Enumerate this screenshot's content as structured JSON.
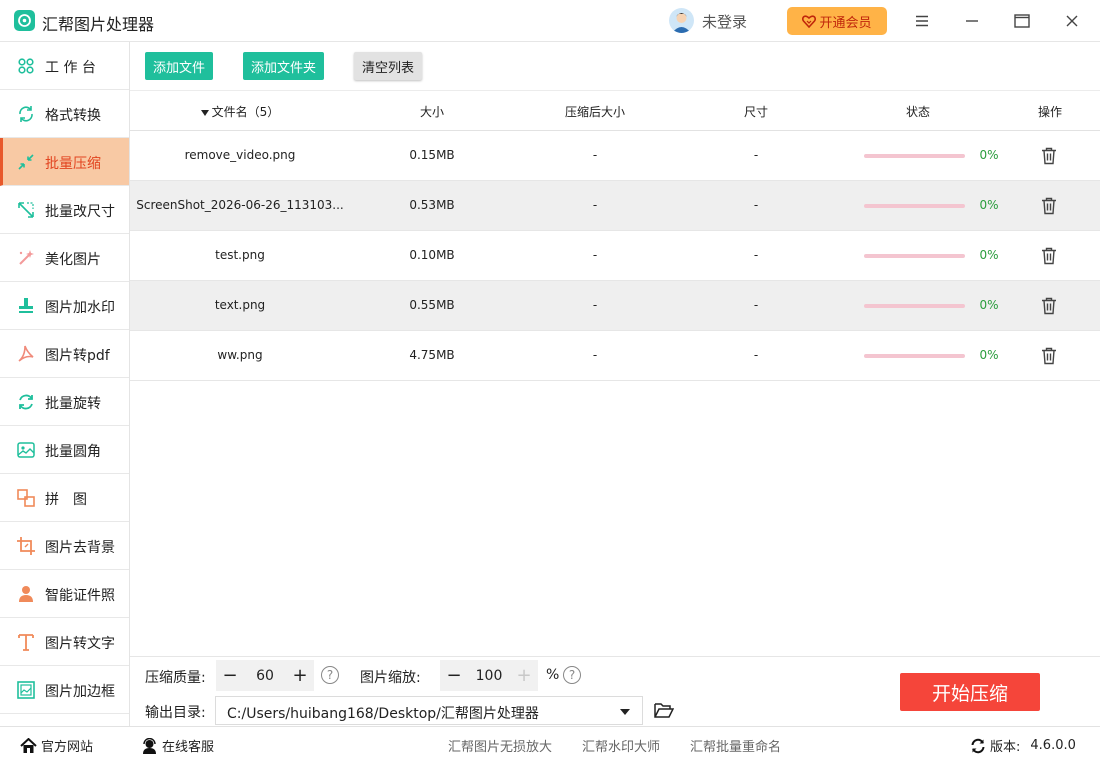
{
  "app": {
    "title": "汇帮图片处理器"
  },
  "header": {
    "login_label": "未登录",
    "vip_label": "开通会员"
  },
  "sidebar": {
    "items": [
      {
        "label": "工 作 台",
        "icon": "grid-icon"
      },
      {
        "label": "格式转换",
        "icon": "convert-icon"
      },
      {
        "label": "批量压缩",
        "icon": "compress-icon",
        "active": true
      },
      {
        "label": "批量改尺寸",
        "icon": "resize-icon"
      },
      {
        "label": "美化图片",
        "icon": "beautify-icon"
      },
      {
        "label": "图片加水印",
        "icon": "stamp-icon"
      },
      {
        "label": "图片转pdf",
        "icon": "pdf-icon"
      },
      {
        "label": "批量旋转",
        "icon": "rotate-icon"
      },
      {
        "label": "批量圆角",
        "icon": "image-icon"
      },
      {
        "label": "拼　图",
        "icon": "puzzle-icon"
      },
      {
        "label": "图片去背景",
        "icon": "crop-icon"
      },
      {
        "label": "智能证件照",
        "icon": "person-icon"
      },
      {
        "label": "图片转文字",
        "icon": "text-icon"
      },
      {
        "label": "图片加边框",
        "icon": "frame-icon"
      }
    ]
  },
  "toolbar": {
    "add_file": "添加文件",
    "add_folder": "添加文件夹",
    "clear_list": "清空列表"
  },
  "table": {
    "headers": {
      "name": "文件名（5）",
      "size": "大小",
      "compressed": "压缩后大小",
      "dimension": "尺寸",
      "status": "状态",
      "action": "操作"
    },
    "rows": [
      {
        "name": "remove_video.png",
        "size": "0.15MB",
        "compressed": "-",
        "dimension": "-",
        "progress": 0,
        "progress_label": "0%"
      },
      {
        "name": "ScreenShot_2026-06-26_113103...",
        "size": "0.53MB",
        "compressed": "-",
        "dimension": "-",
        "progress": 0,
        "progress_label": "0%"
      },
      {
        "name": "test.png",
        "size": "0.10MB",
        "compressed": "-",
        "dimension": "-",
        "progress": 0,
        "progress_label": "0%"
      },
      {
        "name": "text.png",
        "size": "0.55MB",
        "compressed": "-",
        "dimension": "-",
        "progress": 0,
        "progress_label": "0%"
      },
      {
        "name": "ww.png",
        "size": "4.75MB",
        "compressed": "-",
        "dimension": "-",
        "progress": 0,
        "progress_label": "0%"
      }
    ]
  },
  "settings": {
    "quality_label": "压缩质量:",
    "quality_value": "60",
    "scale_label": "图片缩放:",
    "scale_value": "100",
    "scale_unit": "%",
    "help_glyph": "?",
    "minus_glyph": "−",
    "plus_glyph": "+",
    "output_label": "输出目录:",
    "output_path": "C:/Users/huibang168/Desktop/汇帮图片处理器",
    "start_label": "开始压缩"
  },
  "footer": {
    "official_site": "官方网站",
    "online_service": "在线客服",
    "links": [
      "汇帮图片无损放大",
      "汇帮水印大师",
      "汇帮批量重命名"
    ],
    "version_label": "版本:",
    "version": "4.6.0.0"
  },
  "colors": {
    "accent": "#1fbf9c",
    "active_bg": "#f8c9a4",
    "active_text": "#e2441f",
    "start": "#f5453a",
    "vip": "#ffb347",
    "progress_track": "#f4c5d0",
    "progress_text": "#2a9d3d"
  }
}
